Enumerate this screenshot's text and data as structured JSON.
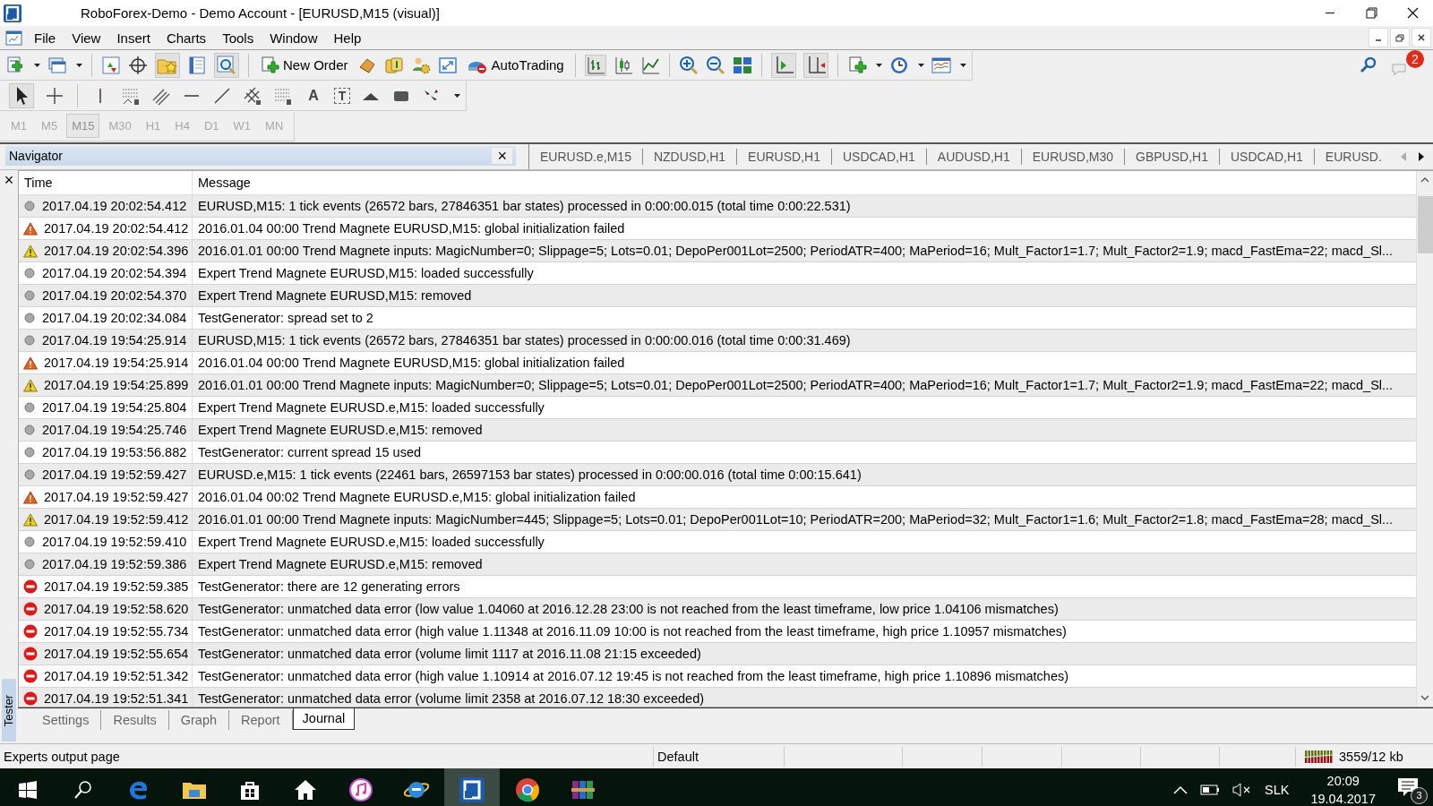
{
  "window": {
    "title": "RoboForex-Demo - Demo Account - [EURUSD,M15 (visual)]"
  },
  "menu": [
    "File",
    "View",
    "Insert",
    "Charts",
    "Tools",
    "Window",
    "Help"
  ],
  "toolbar": {
    "buttons": [
      {
        "label": "New Order"
      },
      {
        "label": "AutoTrading"
      }
    ],
    "notification_count": "2"
  },
  "drawing_tools": {
    "text_tools": [
      "A",
      "T"
    ]
  },
  "timeframes": [
    {
      "label": "M1",
      "selected": false
    },
    {
      "label": "M5",
      "selected": false
    },
    {
      "label": "M15",
      "selected": true
    },
    {
      "label": "M30",
      "selected": false
    },
    {
      "label": "H1",
      "selected": false
    },
    {
      "label": "H4",
      "selected": false
    },
    {
      "label": "D1",
      "selected": false
    },
    {
      "label": "W1",
      "selected": false
    },
    {
      "label": "MN",
      "selected": false
    }
  ],
  "navigator": {
    "title": "Navigator",
    "close": "×"
  },
  "chart_tabs": [
    {
      "label": "EURUSD.e,M15"
    },
    {
      "label": "NZDUSD,H1"
    },
    {
      "label": "EURUSD,H1"
    },
    {
      "label": "USDCAD,H1"
    },
    {
      "label": "AUDUSD,H1"
    },
    {
      "label": "EURUSD,M30"
    },
    {
      "label": "GBPUSD,H1"
    },
    {
      "label": "USDCAD,H1"
    },
    {
      "label": "EURUSD."
    }
  ],
  "journal": {
    "close": "×",
    "panel_label": "Tester",
    "columns": [
      "Time",
      "Message"
    ],
    "rows": [
      {
        "kind": "info",
        "time": "2017.04.19 20:02:54.412",
        "message": "EURUSD,M15: 1 tick events (26572 bars, 27846351 bar states) processed in 0:00:00.015 (total time 0:00:22.531)"
      },
      {
        "kind": "alert",
        "time": "2017.04.19 20:02:54.412",
        "message": "2016.01.04 00:00  Trend Magnete EURUSD,M15: global initialization failed"
      },
      {
        "kind": "warning",
        "time": "2017.04.19 20:02:54.396",
        "message": "2016.01.01 00:00  Trend Magnete inputs: MagicNumber=0; Slippage=5; Lots=0.01; DepoPer001Lot=2500; PeriodATR=400; MaPeriod=16; Mult_Factor1=1.7; Mult_Factor2=1.9; macd_FastEma=22; macd_Sl..."
      },
      {
        "kind": "info",
        "time": "2017.04.19 20:02:54.394",
        "message": "Expert Trend Magnete EURUSD,M15: loaded successfully"
      },
      {
        "kind": "info",
        "time": "2017.04.19 20:02:54.370",
        "message": "Expert Trend Magnete EURUSD,M15: removed"
      },
      {
        "kind": "info",
        "time": "2017.04.19 20:02:34.084",
        "message": "TestGenerator: spread set to 2"
      },
      {
        "kind": "info",
        "time": "2017.04.19 19:54:25.914",
        "message": "EURUSD,M15: 1 tick events (26572 bars, 27846351 bar states) processed in 0:00:00.016 (total time 0:00:31.469)"
      },
      {
        "kind": "alert",
        "time": "2017.04.19 19:54:25.914",
        "message": "2016.01.04 00:00  Trend Magnete EURUSD,M15: global initialization failed"
      },
      {
        "kind": "warning",
        "time": "2017.04.19 19:54:25.899",
        "message": "2016.01.01 00:00  Trend Magnete inputs: MagicNumber=0; Slippage=5; Lots=0.01; DepoPer001Lot=2500; PeriodATR=400; MaPeriod=16; Mult_Factor1=1.7; Mult_Factor2=1.9; macd_FastEma=22; macd_Sl..."
      },
      {
        "kind": "info",
        "time": "2017.04.19 19:54:25.804",
        "message": "Expert Trend Magnete EURUSD.e,M15: loaded successfully"
      },
      {
        "kind": "info",
        "time": "2017.04.19 19:54:25.746",
        "message": "Expert Trend Magnete EURUSD.e,M15: removed"
      },
      {
        "kind": "info",
        "time": "2017.04.19 19:53:56.882",
        "message": "TestGenerator: current spread 15 used"
      },
      {
        "kind": "info",
        "time": "2017.04.19 19:52:59.427",
        "message": "EURUSD.e,M15: 1 tick events (22461 bars, 26597153 bar states) processed in 0:00:00.016 (total time 0:00:15.641)"
      },
      {
        "kind": "alert",
        "time": "2017.04.19 19:52:59.427",
        "message": "2016.01.04 00:02  Trend Magnete EURUSD.e,M15: global initialization failed"
      },
      {
        "kind": "warning",
        "time": "2017.04.19 19:52:59.412",
        "message": "2016.01.01 00:00  Trend Magnete inputs: MagicNumber=445; Slippage=5; Lots=0.01; DepoPer001Lot=10; PeriodATR=200; MaPeriod=32; Mult_Factor1=1.6; Mult_Factor2=1.8; macd_FastEma=28; macd_Sl..."
      },
      {
        "kind": "info",
        "time": "2017.04.19 19:52:59.410",
        "message": "Expert Trend Magnete EURUSD.e,M15: loaded successfully"
      },
      {
        "kind": "info",
        "time": "2017.04.19 19:52:59.386",
        "message": "Expert Trend Magnete EURUSD.e,M15: removed"
      },
      {
        "kind": "error",
        "time": "2017.04.19 19:52:59.385",
        "message": "TestGenerator: there are 12 generating errors"
      },
      {
        "kind": "error",
        "time": "2017.04.19 19:52:58.620",
        "message": "TestGenerator: unmatched data error (low value 1.04060 at 2016.12.28 23:00 is not reached from the least timeframe, low price 1.04106 mismatches)"
      },
      {
        "kind": "error",
        "time": "2017.04.19 19:52:55.734",
        "message": "TestGenerator: unmatched data error (high value 1.11348 at 2016.11.09 10:00 is not reached from the least timeframe, high price 1.10957 mismatches)"
      },
      {
        "kind": "error",
        "time": "2017.04.19 19:52:55.654",
        "message": "TestGenerator: unmatched data error (volume limit 1117 at 2016.11.08 21:15 exceeded)"
      },
      {
        "kind": "error",
        "time": "2017.04.19 19:52:51.342",
        "message": "TestGenerator: unmatched data error (high value 1.10914 at 2016.07.12 19:45 is not reached from the least timeframe, high price 1.10896 mismatches)"
      },
      {
        "kind": "error",
        "time": "2017.04.19 19:52:51.341",
        "message": "TestGenerator: unmatched data error (volume limit 2358 at 2016.07.12 18:30 exceeded)"
      }
    ]
  },
  "panel_tabs": [
    {
      "label": "Settings",
      "selected": false
    },
    {
      "label": "Results",
      "selected": false
    },
    {
      "label": "Graph",
      "selected": false
    },
    {
      "label": "Report",
      "selected": false
    },
    {
      "label": "Journal",
      "selected": true
    }
  ],
  "status_bar": {
    "message": "Experts output page",
    "profile": "Default",
    "traffic": "3559/12 kb"
  },
  "taskbar": {
    "tray_language": "SLK",
    "clock_time": "20:09",
    "clock_date": "19.04.2017",
    "notification_count": "3"
  }
}
